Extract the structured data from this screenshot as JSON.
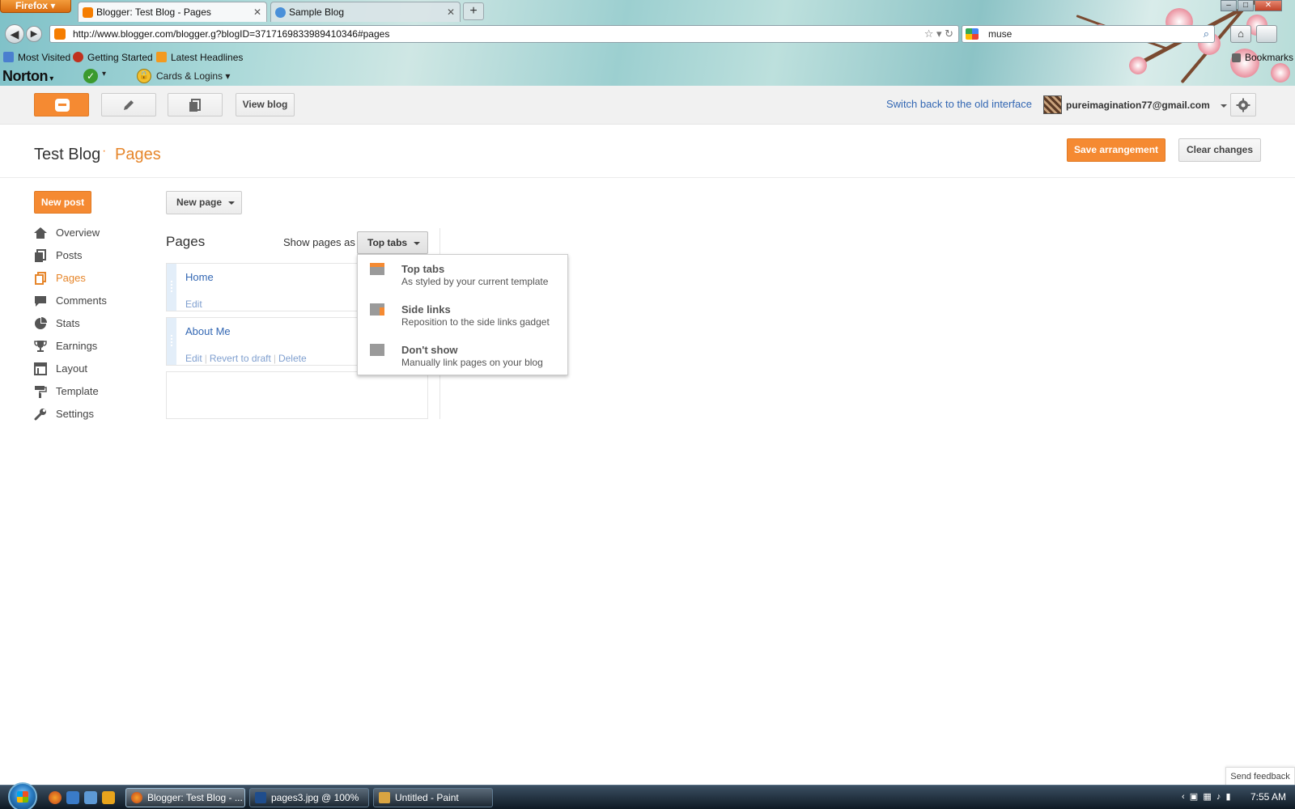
{
  "browser": {
    "menu_button": "Firefox",
    "tabs": [
      {
        "label": "Blogger: Test Blog - Pages",
        "active": true
      },
      {
        "label": "Sample Blog",
        "active": false
      }
    ],
    "new_tab": "+",
    "url": "http://www.blogger.com/blogger.g?blogID=3717169833989410346#pages",
    "search_value": "muse",
    "bookmarks": [
      "Most Visited",
      "Getting Started",
      "Latest Headlines"
    ],
    "bookmarks_menu": "Bookmarks",
    "norton_label": "Norton",
    "cards_label": "Cards & Logins"
  },
  "header": {
    "view_blog": "View blog",
    "switch_link": "Switch back to the old interface",
    "account_email": "pureimagination77@gmail.com"
  },
  "title_area": {
    "blog_title": "Test Blog",
    "separator": "·",
    "section": "Pages",
    "save_button": "Save arrangement",
    "clear_button": "Clear changes"
  },
  "sidebar": {
    "new_post": "New post",
    "items": [
      {
        "label": "Overview",
        "icon": "home-icon"
      },
      {
        "label": "Posts",
        "icon": "posts-icon"
      },
      {
        "label": "Pages",
        "icon": "pages-icon",
        "active": true
      },
      {
        "label": "Comments",
        "icon": "comment-icon"
      },
      {
        "label": "Stats",
        "icon": "pie-chart-icon"
      },
      {
        "label": "Earnings",
        "icon": "trophy-icon"
      },
      {
        "label": "Layout",
        "icon": "layout-icon"
      },
      {
        "label": "Template",
        "icon": "paint-roller-icon"
      },
      {
        "label": "Settings",
        "icon": "wrench-icon"
      }
    ]
  },
  "main": {
    "new_page": "New page",
    "heading": "Pages",
    "show_as_label": "Show pages as",
    "show_as_value": "Top tabs",
    "pages": [
      {
        "name": "Home",
        "actions": [
          "Edit"
        ]
      },
      {
        "name": "About Me",
        "actions": [
          "Edit",
          "Revert to draft",
          "Delete"
        ]
      }
    ],
    "dropdown": [
      {
        "title": "Top tabs",
        "subtitle": "As styled by your current template"
      },
      {
        "title": "Side links",
        "subtitle": "Reposition to the side links gadget"
      },
      {
        "title": "Don't show",
        "subtitle": "Manually link pages on your blog"
      }
    ]
  },
  "feedback": "Send feedback",
  "taskbar": {
    "buttons": [
      "Blogger: Test Blog - ...",
      "pages3.jpg @ 100% ...",
      "Untitled - Paint"
    ],
    "clock": "7:55 AM"
  },
  "colors": {
    "accent": "#f58a32",
    "link": "#3367b3",
    "active_nav": "#e6862b"
  }
}
